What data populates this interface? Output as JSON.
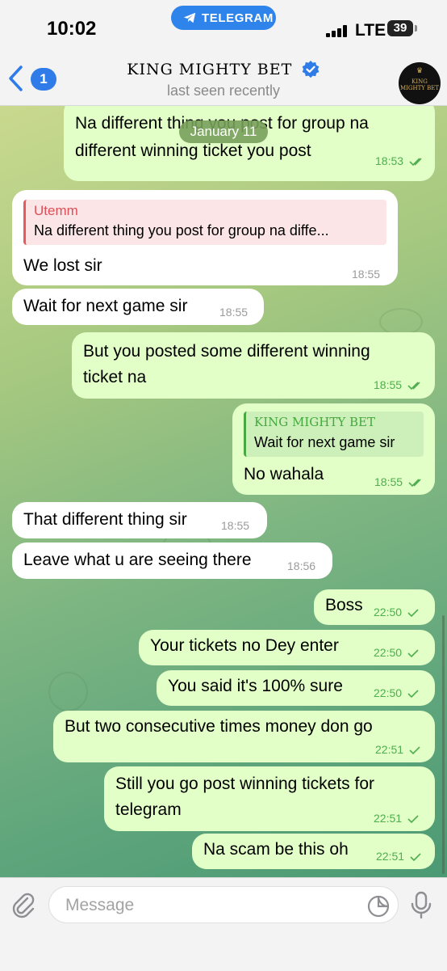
{
  "status_bar": {
    "time": "10:02",
    "app_pill": "TELEGRAM",
    "network": "LTE",
    "battery": "39"
  },
  "header": {
    "back_badge": "1",
    "title": "KING MIGHTY BET",
    "subtitle": "last seen recently",
    "avatar_text": "KING MIGHTY BET"
  },
  "chat": {
    "date_pill": "January 11",
    "messages": [
      {
        "dir": "out",
        "text_line1": "Na different thing you post for group na",
        "text_line2": "different winning ticket you post",
        "time": "18:53"
      },
      {
        "dir": "in",
        "quote_name": "Utemm",
        "quote_text": "Na different thing you post for group na diffe...",
        "text": "We lost sir",
        "time": "18:55"
      },
      {
        "dir": "in",
        "text": "Wait for next game sir",
        "time": "18:55"
      },
      {
        "dir": "out",
        "text_line1": "But you posted some different winning",
        "text_line2": "ticket na",
        "time": "18:55"
      },
      {
        "dir": "out",
        "quote_name": "KING MIGHTY BET",
        "quote_text": "Wait for next game sir",
        "text": "No wahala",
        "time": "18:55"
      },
      {
        "dir": "in",
        "text": "That different thing sir",
        "time": "18:55"
      },
      {
        "dir": "in",
        "text": "Leave what u are seeing there",
        "time": "18:56"
      },
      {
        "dir": "out",
        "text": "Boss",
        "time": "22:50"
      },
      {
        "dir": "out",
        "text": "Your tickets no Dey enter",
        "time": "22:50"
      },
      {
        "dir": "out",
        "text": "You said it's 100% sure",
        "time": "22:50"
      },
      {
        "dir": "out",
        "text": "But two consecutive times money don go",
        "time": "22:51"
      },
      {
        "dir": "out",
        "text_line1": "Still you go post winning tickets for",
        "text_line2": "telegram",
        "time": "22:51"
      },
      {
        "dir": "out",
        "text": "Na scam be this oh",
        "time": "22:51"
      }
    ]
  },
  "input": {
    "placeholder": "Message"
  },
  "icons": {
    "back": "chevron-left-icon",
    "verified": "verified-badge-icon",
    "attach": "paperclip-icon",
    "sticker": "sticker-icon",
    "mic": "microphone-icon",
    "read": "double-check-icon"
  },
  "colors": {
    "accent": "#2f7ce8",
    "outgoing_bubble": "#e1ffc7",
    "incoming_bubble": "#ffffff",
    "check": "#4fae4e"
  }
}
